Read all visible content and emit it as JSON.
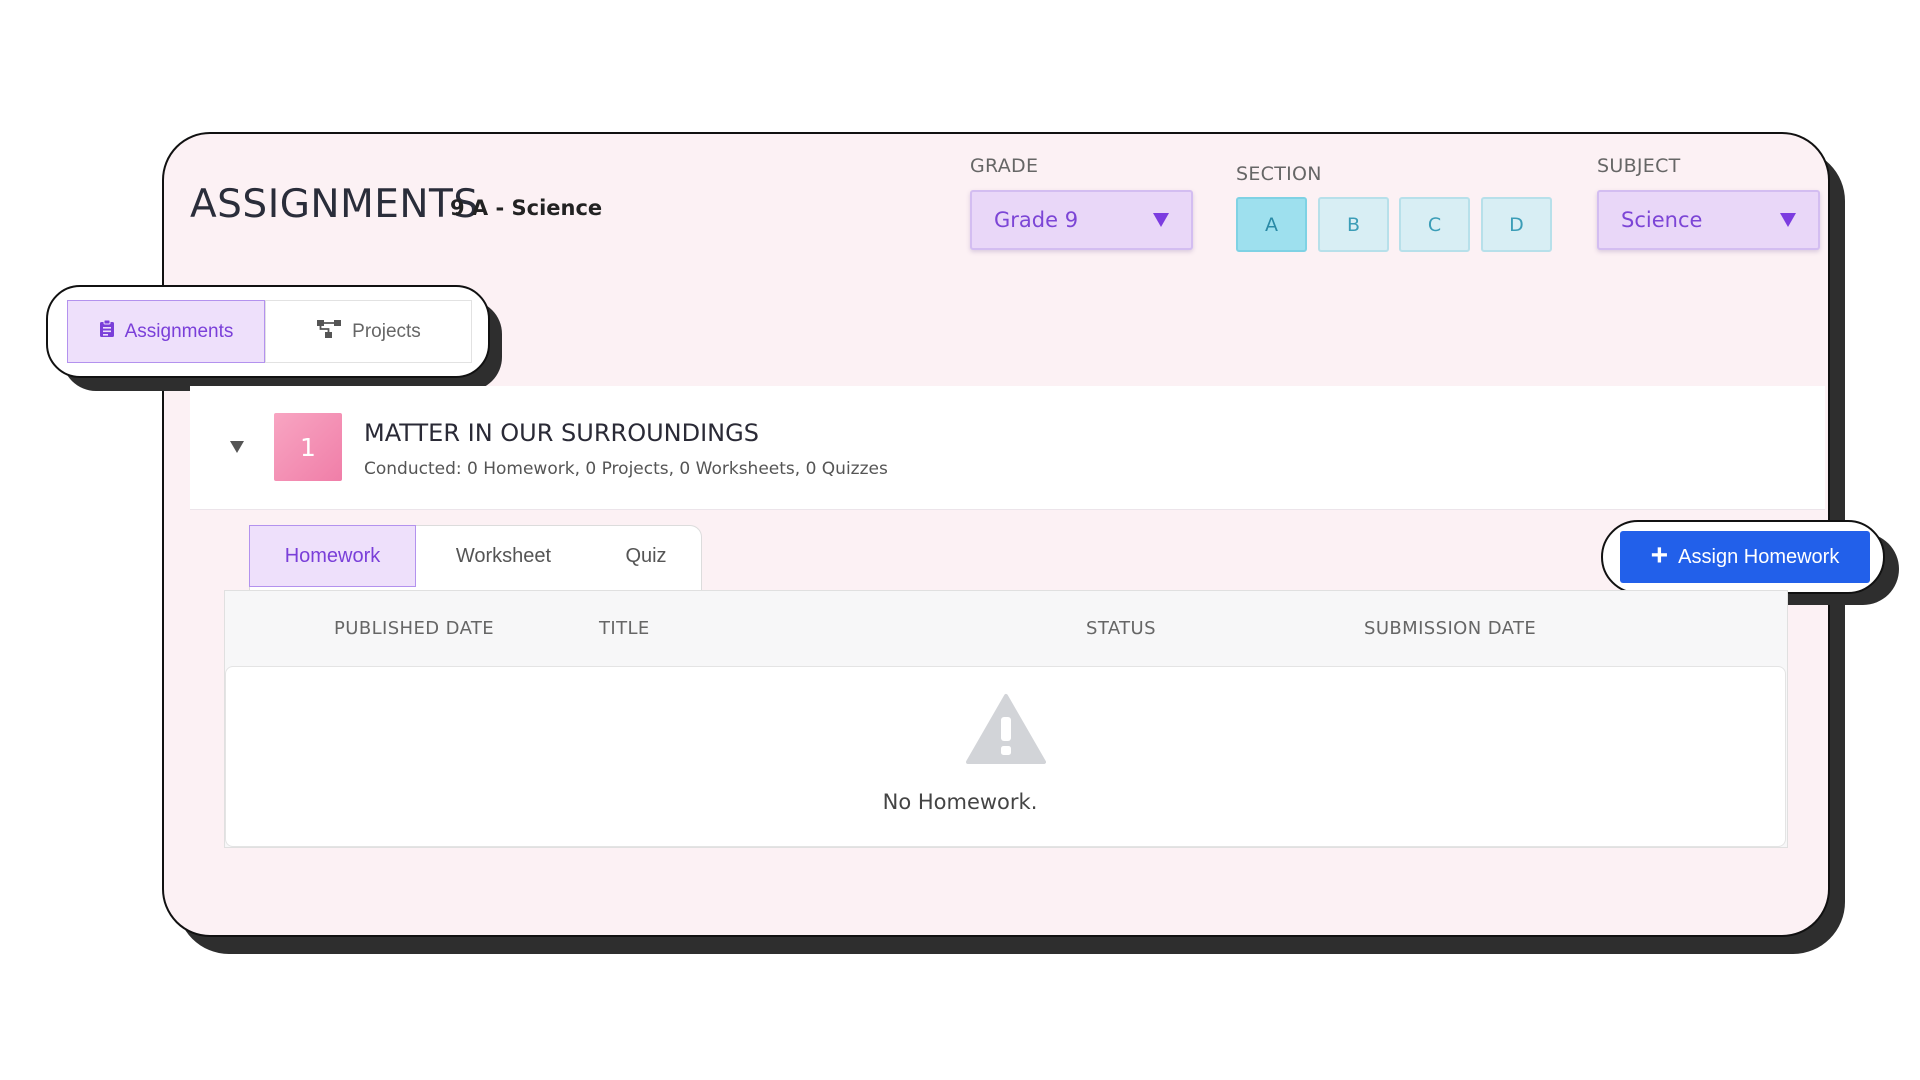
{
  "header": {
    "title": "ASSIGNMENTS",
    "subtitle": "9 A - Science"
  },
  "filters": {
    "grade": {
      "label": "GRADE",
      "value": "Grade 9"
    },
    "section": {
      "label": "SECTION",
      "options": [
        "A",
        "B",
        "C",
        "D"
      ],
      "selected": "A"
    },
    "subject": {
      "label": "SUBJECT",
      "value": "Science"
    }
  },
  "view_toggle": {
    "items": [
      {
        "label": "Assignments",
        "icon": "clipboard-icon",
        "active": true
      },
      {
        "label": "Projects",
        "icon": "hierarchy-icon",
        "active": false
      }
    ]
  },
  "chapter": {
    "number": "1",
    "title": "MATTER IN OUR SURROUNDINGS",
    "meta": "Conducted: 0 Homework, 0 Projects, 0 Worksheets, 0 Quizzes"
  },
  "content_tabs": [
    {
      "label": "Homework",
      "active": true
    },
    {
      "label": "Worksheet",
      "active": false
    },
    {
      "label": "Quiz",
      "active": false
    }
  ],
  "assign_button": {
    "label": "Assign Homework",
    "icon": "plus-icon"
  },
  "table": {
    "columns": [
      "PUBLISHED DATE",
      "TITLE",
      "STATUS",
      "SUBMISSION DATE"
    ],
    "empty_message": "No Homework.",
    "empty_icon": "warning-icon"
  },
  "colors": {
    "card_bg": "#fcf1f4",
    "accent_purple": "#7a3fd9",
    "section_active": "#9ee0ee",
    "primary_button": "#2260ea",
    "chapter_badge": "#f07ea8"
  }
}
